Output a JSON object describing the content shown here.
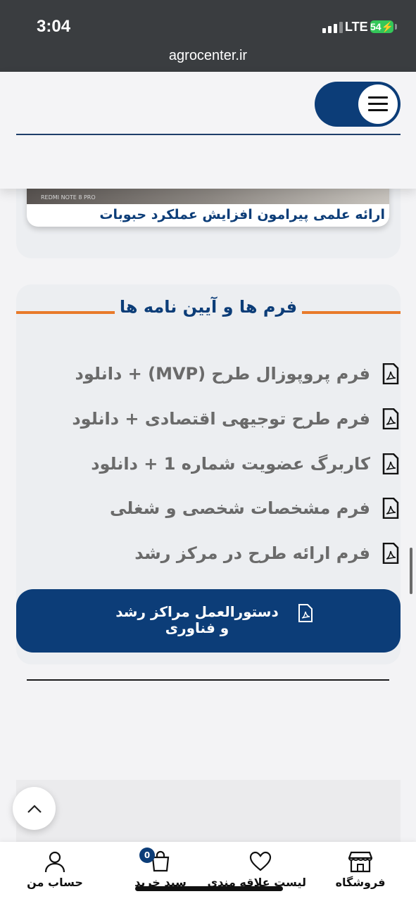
{
  "status_bar": {
    "time": "3:04",
    "network": "LTE",
    "battery": "54"
  },
  "browser": {
    "url": "agrocenter.ir"
  },
  "news": {
    "image_caption": "REDMI NOTE 8 PRO",
    "title": "ارائه علمی پیرامون افزایش عملکرد حبوبات"
  },
  "forms_section": {
    "title": "فرم ها و آیین نامه ها",
    "items": [
      {
        "label": "فرم پروپوزال طرح (MVP) + دانلود"
      },
      {
        "label": "فرم طرح توجیهی اقتصادی + دانلود"
      },
      {
        "label": "کاربرگ عضویت شماره 1 + دانلود"
      },
      {
        "label": "فرم مشخصات شخصی و شغلی"
      },
      {
        "label": "فرم ارائه طرح در مرکز رشد"
      }
    ],
    "guide_button": "دستورالعمل مراکز رشد و فناوری"
  },
  "bottom_nav": {
    "shop": "فروشگاه",
    "wishlist": "لیست علاقه مندی",
    "cart": "سبد خرید",
    "cart_count": "0",
    "account": "حساب من"
  },
  "colors": {
    "brand_blue": "#0c3d78",
    "accent_orange": "#e87a2a"
  }
}
